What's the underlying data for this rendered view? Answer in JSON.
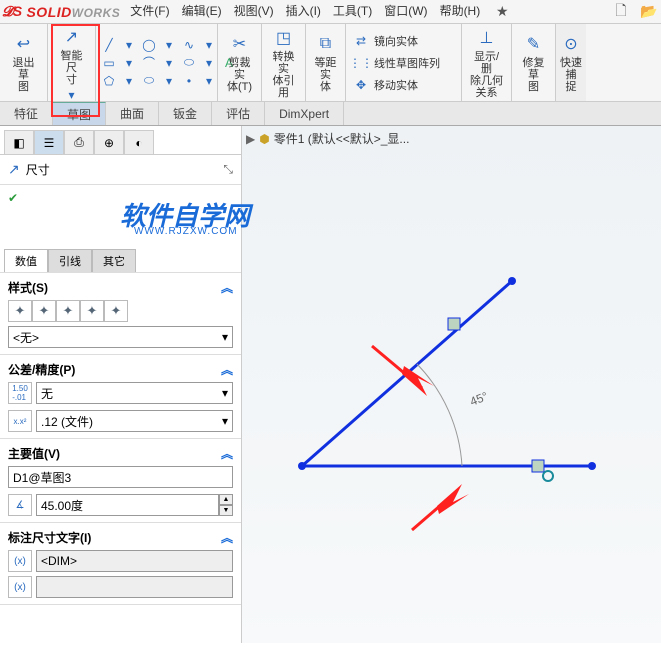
{
  "app": {
    "menus": [
      "文件(F)",
      "编辑(E)",
      "视图(V)",
      "插入(I)",
      "工具(T)",
      "窗口(W)",
      "帮助(H)"
    ]
  },
  "ribbon": {
    "exit_sketch": "退出草\n图",
    "smart_dim": "智能尺\n寸",
    "trim": "剪裁实\n体(T)",
    "convert": "转换实\n体引用",
    "offset": "等距实\n体",
    "mirror": "镜向实体",
    "pattern": "线性草图阵列",
    "move": "移动实体",
    "rel": "显示/删\n除几何\n关系",
    "repair": "修复草\n图",
    "snap": "快速捕\n捉"
  },
  "tabs": {
    "feature": "特征",
    "sketch": "草图",
    "surface": "曲面",
    "sheet": "钣金",
    "eval": "评估",
    "dx": "DimXpert"
  },
  "panel": {
    "title": "尺寸",
    "sub_tabs": {
      "val": "数值",
      "lead": "引线",
      "other": "其它"
    },
    "style_head": "样式(S)",
    "style_dd": "<无>",
    "tol_head": "公差/精度(P)",
    "tol_dd": "无",
    "prec_dd": ".12 (文件)",
    "main_head": "主要值(V)",
    "main_name": "D1@草图3",
    "main_val": "45.00度",
    "dimtext_head": "标注尺寸文字(I)",
    "dimtext_val": "<DIM>"
  },
  "breadcrumb": "零件1  (默认<<默认>_显...",
  "watermark": "软件自学网",
  "watermark_sub": "WWW.RJZXW.COM",
  "angle_label": "45°"
}
